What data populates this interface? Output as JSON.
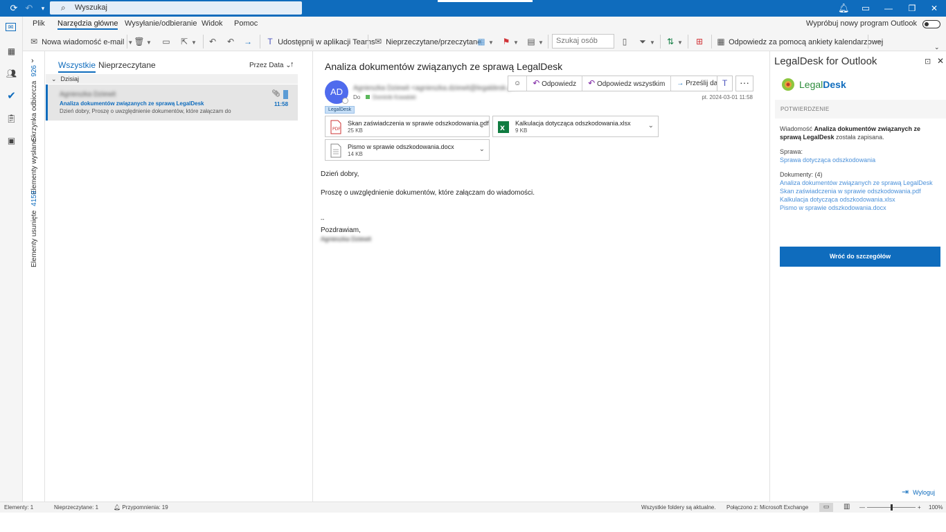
{
  "titlebar": {
    "search_placeholder": "Wyszukaj"
  },
  "menu": {
    "items": [
      "Plik",
      "Narzędzia główne",
      "Wysyłanie/odbieranie",
      "Widok",
      "Pomoc"
    ],
    "try_new": "Wypróbuj nowy program Outlook"
  },
  "ribbon": {
    "new_email": "Nowa wiadomość e-mail",
    "share_teams": "Udostępnij w aplikacji Teams",
    "unread_read": "Nieprzeczytane/przeczytane",
    "search_people": "Szukaj osób",
    "reply_survey": "Odpowiedz za pomocą ankiety kalendarzowej",
    "more": "···"
  },
  "folders": {
    "inbox": {
      "label": "Skrzynka odbiorcza",
      "count": "926"
    },
    "sent": {
      "label": "Elementy wysłane"
    },
    "deleted": {
      "label": "Elementy usunięte",
      "count": "4159"
    }
  },
  "list": {
    "tab_all": "Wszystkie",
    "tab_unread": "Nieprzeczytane",
    "sort": "Przez Data",
    "group": "Dzisiaj",
    "item": {
      "sender": "Agnieszka Dziewit",
      "subject": "Analiza dokumentów związanych ze sprawą LegalDesk",
      "preview": "Dzień dobry,  Proszę o uwzględnienie dokumentów, które załączam do",
      "time": "11:58"
    }
  },
  "message": {
    "subject": "Analiza dokumentów związanych ze sprawą LegalDesk",
    "avatar": "AD",
    "from": "Agnieszka Dziewit <agnieszka.dziewit@legaldesk.pl>",
    "to_label": "Do",
    "to": "Dominik Kowalski",
    "datetime": "pt. 2024-03-01 11:58",
    "tag": "LegalDesk",
    "actions": {
      "reply": "Odpowiedz",
      "reply_all": "Odpowiedz wszystkim",
      "forward": "Prześlij dalej"
    },
    "attachments": [
      {
        "name": "Skan zaświadczenia w sprawie odszkodowania.pdf",
        "size": "25 KB"
      },
      {
        "name": "Kalkulacja dotycząca odszkodowania.xlsx",
        "size": "9 KB"
      },
      {
        "name": "Pismo w sprawie odszkodowania.docx",
        "size": "14 KB"
      }
    ],
    "body": {
      "greeting": "Dzień dobry,",
      "line1": "Proszę o uwzględnienie dokumentów, które załączam do wiadomości.",
      "sigsep": "--",
      "closing": "Pozdrawiam,",
      "signature": "Agnieszka Dziewit"
    }
  },
  "sidepane": {
    "title": "LegalDesk for Outlook",
    "logo_a": "Legal",
    "logo_b": "Desk",
    "section": "POTWIERDZENIE",
    "saved_pre": "Wiadomość ",
    "saved_bold": "Analiza dokumentów związanych ze sprawą LegalDesk",
    "saved_post": " została zapisana.",
    "case_label": "Sprawa:",
    "case_link": "Sprawa dotycząca odszkodowania",
    "docs_label": "Dokumenty: (4)",
    "docs": [
      "Analiza dokumentów związanych ze sprawą LegalDesk",
      "Skan zaświadczenia w sprawie odszkodowania.pdf",
      "Kalkulacja dotycząca odszkodowania.xlsx",
      "Pismo w sprawie odszkodowania.docx"
    ],
    "back_button": "Wróć do szczegółów",
    "logout": "Wyloguj"
  },
  "status": {
    "elements": "Elementy: 1",
    "unread": "Nieprzeczytane: 1",
    "reminders": "Przypomnienia: 19",
    "folders_ok": "Wszystkie foldery są aktualne.",
    "connected": "Połączono z: Microsoft Exchange",
    "zoom": "100%"
  },
  "colors": {
    "accent": "#0f6cbd",
    "avatar": "#4f6bed",
    "link": "#4a90d9"
  }
}
